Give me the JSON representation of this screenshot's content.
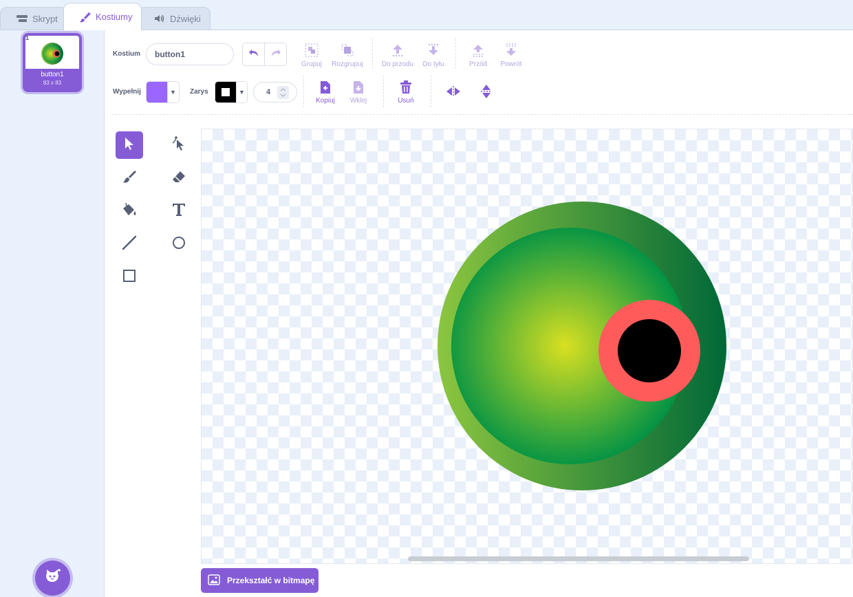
{
  "tabs": [
    {
      "label": "Skrypt",
      "icon": "code-icon"
    },
    {
      "label": "Kostiumy",
      "icon": "brush-icon",
      "active": true
    },
    {
      "label": "Dźwięki",
      "icon": "speaker-icon"
    }
  ],
  "costumes": [
    {
      "number": "1",
      "name": "button1",
      "size": "83 x 83",
      "selected": true
    }
  ],
  "toolbar": {
    "costume_label": "Kostium",
    "costume_name": "button1",
    "fill_label": "Wypełnij",
    "outline_label": "Zarys",
    "outline_width": "4",
    "group": "Grupuj",
    "ungroup": "Rozgrupuj",
    "forward": "Do przodu",
    "backward": "Do tyłu",
    "front": "Przód",
    "back": "Powrót",
    "copy": "Kopiuj",
    "paste": "Wklej",
    "delete": "Usuń"
  },
  "tools": [
    "select",
    "reshape",
    "brush",
    "eraser",
    "fill",
    "text",
    "line",
    "circle",
    "rectangle"
  ],
  "active_tool": "select",
  "convert_button": "Przekształć w bitmapę",
  "colors": {
    "accent": "#855cd6",
    "fill": "#9966ff",
    "outline": "#000000",
    "eye_outer_light": "#8cc63f",
    "eye_outer_dark": "#006837",
    "eye_inner_center": "#d9e021",
    "eye_inner_edge": "#009245",
    "iris": "#ff5b5b",
    "pupil": "#000000"
  }
}
